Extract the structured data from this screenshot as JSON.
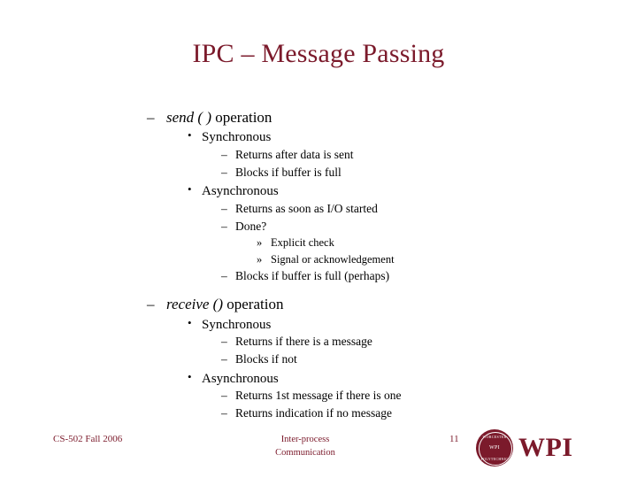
{
  "slide": {
    "title": "IPC – Message Passing",
    "colors": {
      "accent": "#7b1a2b",
      "background": "#ffffff",
      "text": "#000000"
    },
    "bullets": {
      "dash": "–",
      "dot": "•",
      "angle": "»"
    },
    "send": {
      "heading_italic": "send ( )",
      "heading_plain": "operation",
      "synchronous": "Synchronous",
      "sync_items": [
        "Returns after data is sent",
        "Blocks if buffer is full"
      ],
      "asynchronous": "Asynchronous",
      "async_items": [
        "Returns as soon as I/O started",
        "Done?"
      ],
      "done_subitems": [
        "Explicit check",
        "Signal or acknowledgement"
      ],
      "async_last_item": "Blocks if buffer is full (perhaps)"
    },
    "receive": {
      "heading_italic": "receive ()",
      "heading_plain": "operation",
      "synchronous": "Synchronous",
      "sync_items": [
        "Returns if there is a message",
        "Blocks if not"
      ],
      "asynchronous": "Asynchronous",
      "async_items": [
        "Returns 1st message if there is one",
        "Returns indication if no message"
      ]
    },
    "footer": {
      "course": "CS-502 Fall 2006",
      "center_line1": "Inter-process",
      "center_line2": "Communication",
      "page_number": "11",
      "logo_word": "WPI",
      "seal_top": "WORCESTER",
      "seal_mid": "WPI",
      "seal_bot": "POLYTECHNIC"
    }
  }
}
